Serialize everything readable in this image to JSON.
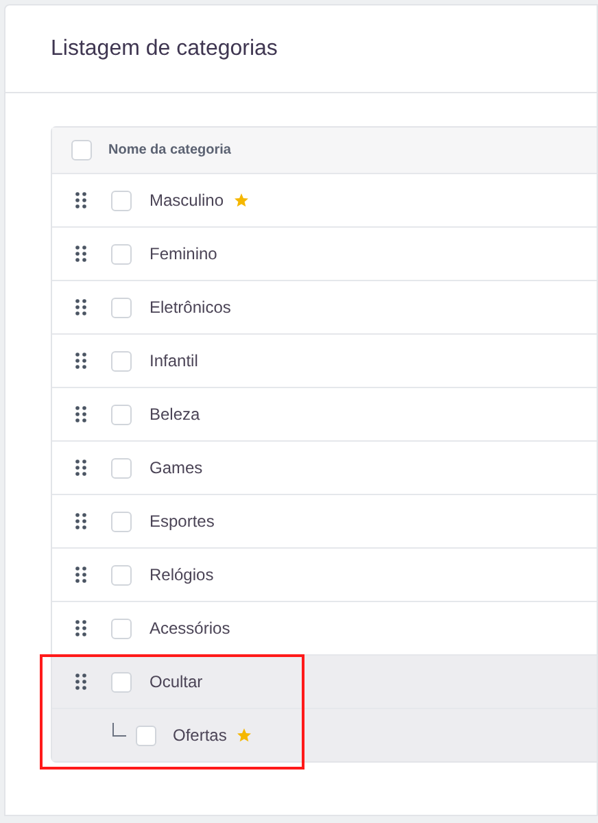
{
  "title": "Listagem de categorias",
  "table": {
    "header": {
      "label": "Nome da categoria",
      "checked": false
    },
    "rows": [
      {
        "name": "Masculino",
        "featured": true,
        "checked": false,
        "hidden": false,
        "highlighted": false
      },
      {
        "name": "Feminino",
        "featured": false,
        "checked": false,
        "hidden": false,
        "highlighted": false
      },
      {
        "name": "Eletrônicos",
        "featured": false,
        "checked": false,
        "hidden": false,
        "highlighted": false
      },
      {
        "name": "Infantil",
        "featured": false,
        "checked": false,
        "hidden": false,
        "highlighted": false
      },
      {
        "name": "Beleza",
        "featured": false,
        "checked": false,
        "hidden": false,
        "highlighted": false
      },
      {
        "name": "Games",
        "featured": false,
        "checked": false,
        "hidden": false,
        "highlighted": false
      },
      {
        "name": "Esportes",
        "featured": false,
        "checked": false,
        "hidden": false,
        "highlighted": false
      },
      {
        "name": "Relógios",
        "featured": false,
        "checked": false,
        "hidden": false,
        "highlighted": false
      },
      {
        "name": "Acessórios",
        "featured": false,
        "checked": false,
        "hidden": false,
        "highlighted": false
      },
      {
        "name": "Ocultar",
        "featured": false,
        "checked": false,
        "hidden": true,
        "highlighted": true,
        "children": [
          {
            "name": "Ofertas",
            "featured": true,
            "checked": false,
            "hidden": true
          }
        ]
      }
    ]
  }
}
